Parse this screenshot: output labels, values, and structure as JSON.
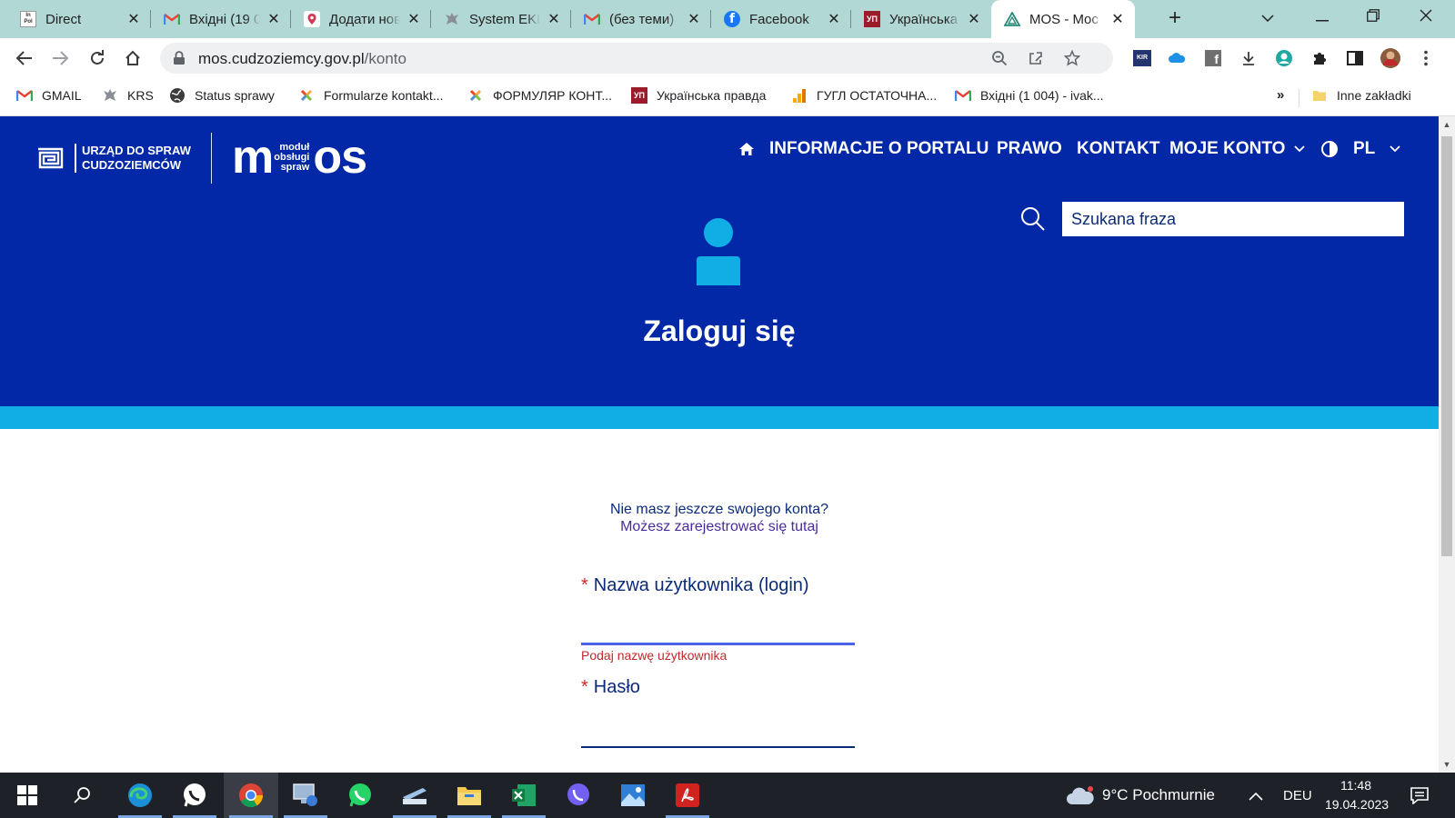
{
  "browser": {
    "tabs": [
      {
        "title": "Direct",
        "favicon": "inpol-icon"
      },
      {
        "title": "Вхідні (19 0",
        "favicon": "gmail-icon"
      },
      {
        "title": "Додати нов",
        "favicon": "map-pin-icon"
      },
      {
        "title": "System EKR",
        "favicon": "eagle-emblem-icon"
      },
      {
        "title": "(без теми)",
        "favicon": "gmail-icon"
      },
      {
        "title": "Facebook",
        "favicon": "facebook-icon"
      },
      {
        "title": "Українська",
        "favicon": "up-icon"
      },
      {
        "title": "MOS - Moc",
        "favicon": "mos-triangle-icon",
        "active": true
      }
    ],
    "favicon_labels": {
      "inpol": "In Pol",
      "up": "УП"
    },
    "url": {
      "host": "mos.cudzoziemcy.gov.pl",
      "path": "/konto"
    },
    "extension_labels": {
      "kir": "KIR"
    },
    "bookmarks": [
      {
        "label": "GMAIL",
        "icon": "gmail-icon"
      },
      {
        "label": "KRS",
        "icon": "eagle-emblem-icon"
      },
      {
        "label": "Status sprawy",
        "icon": "globe-icon"
      },
      {
        "label": "Formularze kontakt...",
        "icon": "joomla-icon"
      },
      {
        "label": "ФОРМУЛЯР КОНТ...",
        "icon": "joomla-icon"
      },
      {
        "label": "Українська правда",
        "icon": "up-icon"
      },
      {
        "label": "ГУГЛ ОСТАТОЧНА...",
        "icon": "analytics-icon"
      },
      {
        "label": "Вхідні (1 004) - ivak...",
        "icon": "gmail-icon"
      }
    ],
    "bookmarks_overflow": "»",
    "other_bookmarks": "Inne zakładki"
  },
  "site": {
    "logo_urzad": {
      "line1": "URZĄD DO SPRAW",
      "line2": "CUDZOZIEMCÓW"
    },
    "logo_mos": {
      "m": "m",
      "small1": "moduł",
      "small2": "obsługi",
      "small3": "spraw",
      "os": "os"
    },
    "nav": {
      "info": "INFORMACJE O PORTALU",
      "law": "PRAWO",
      "contact": "KONTAKT",
      "account": "MOJE KONTO",
      "lang": "PL"
    },
    "search": {
      "placeholder": "Szukana fraza"
    },
    "login_title": "Zaloguj się",
    "register": {
      "line1": "Nie masz jeszcze swojego konta?",
      "line2": "Możesz zarejestrować się tutaj"
    },
    "form": {
      "required_mark": "*",
      "username_label": "Nazwa użytkownika (login)",
      "username_value": "",
      "username_error": "Podaj nazwę użytkownika",
      "password_label": "Hasło",
      "password_value": ""
    }
  },
  "taskbar": {
    "apps": [
      "start-icon",
      "search-icon",
      "edge-icon",
      "whatsapp-icon",
      "chrome-icon",
      "remote-desktop-icon",
      "whatsapp-icon",
      "scanner-icon",
      "file-explorer-icon",
      "excel-icon",
      "viber-icon",
      "photos-icon",
      "acrobat-icon"
    ],
    "active_app": "chrome-icon",
    "weather": {
      "temp": "9°C",
      "desc": "Pochmurnie"
    },
    "language": "DEU",
    "time": "11:48",
    "date": "19.04.2023"
  },
  "colors": {
    "hero_bg": "#0228a8",
    "accent_strip": "#11aee6",
    "tabstrip_bg": "#b2d8d5",
    "text_navy": "#0b2a78",
    "error_red": "#c0282d"
  }
}
